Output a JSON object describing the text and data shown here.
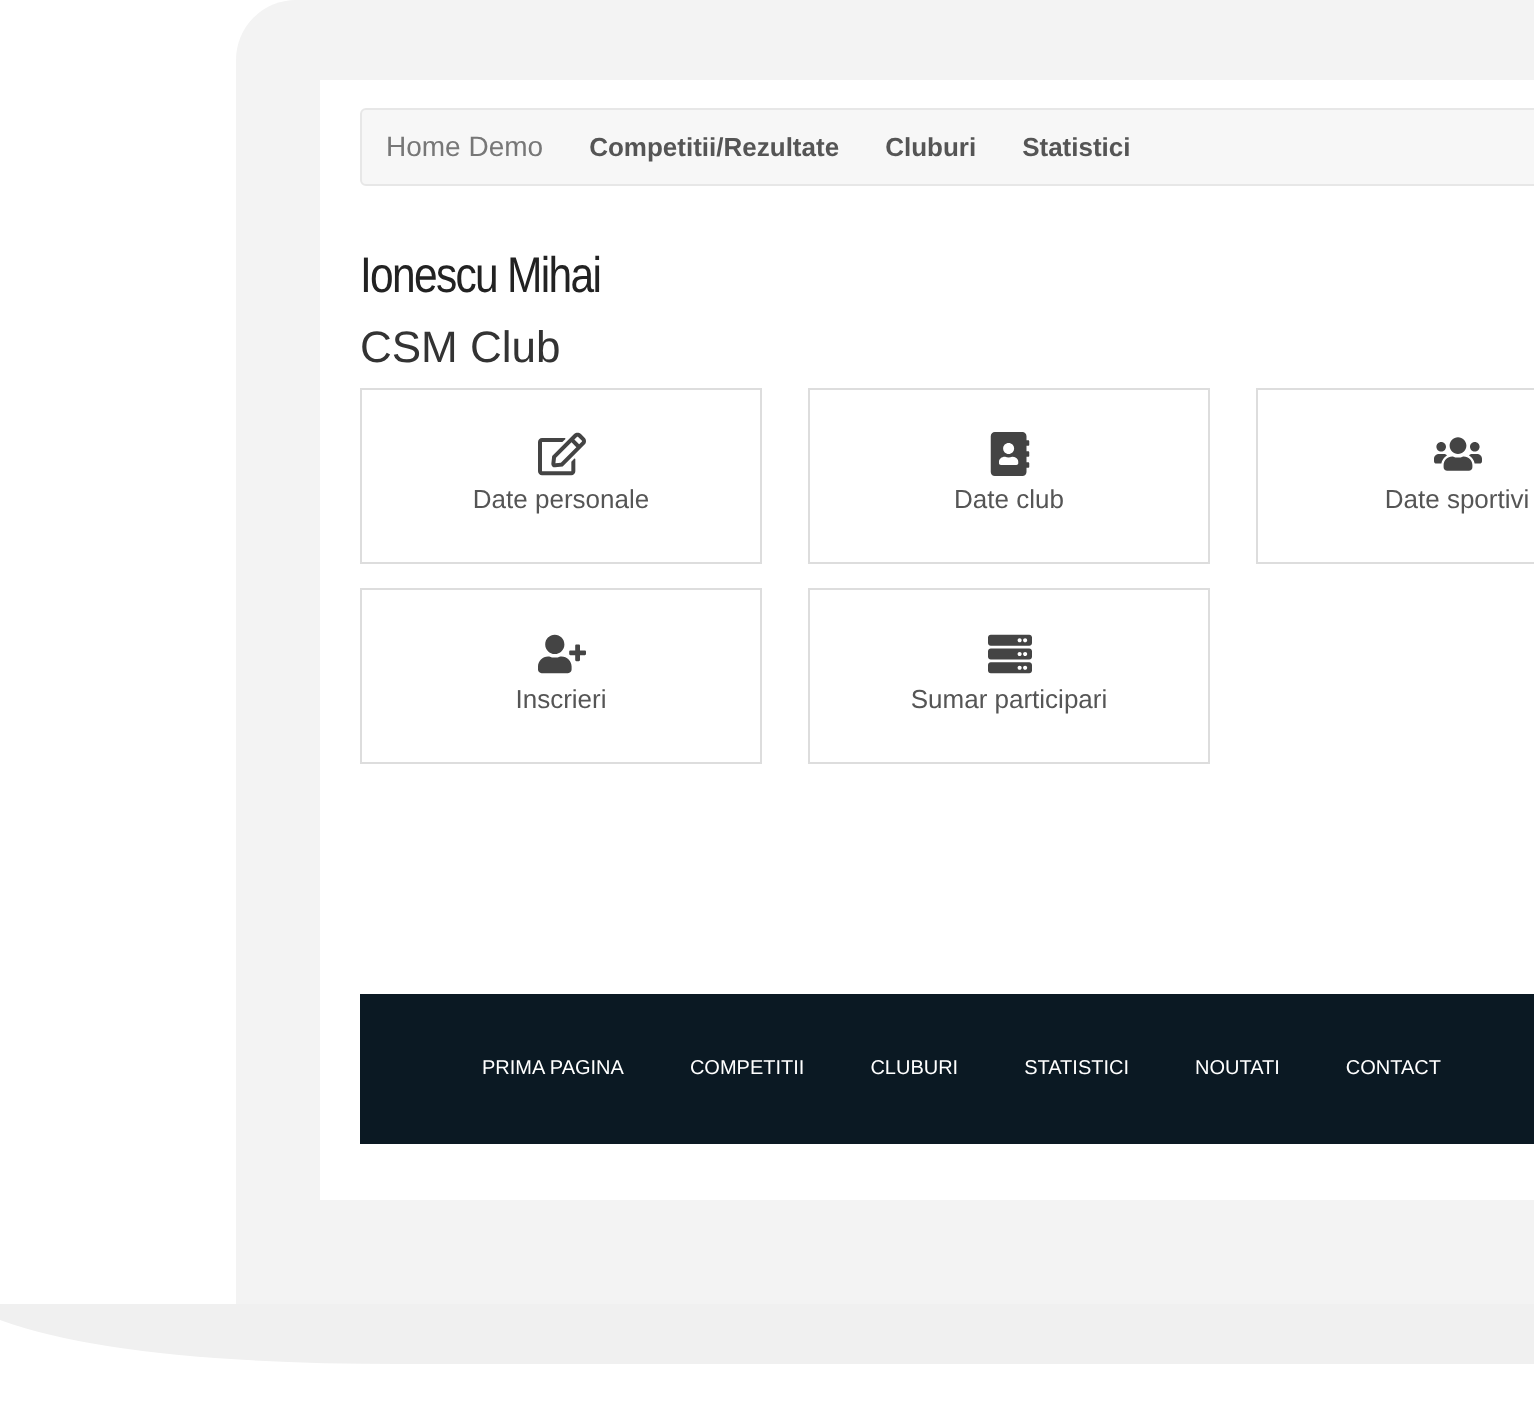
{
  "navbar": {
    "brand": "Home Demo",
    "links": [
      "Competitii/Rezultate",
      "Cluburi",
      "Statistici"
    ]
  },
  "user_name": "Ionescu Mihai",
  "club_name": "CSM Club",
  "cards": [
    {
      "label": "Date personale"
    },
    {
      "label": "Date club"
    },
    {
      "label": "Date sportivi"
    },
    {
      "label": "Inscrieri"
    },
    {
      "label": "Sumar participari"
    }
  ],
  "footer": {
    "links": [
      "PRIMA PAGINA",
      "COMPETITII",
      "CLUBURI",
      "STATISTICI",
      "NOUTATI",
      "CONTACT"
    ]
  }
}
